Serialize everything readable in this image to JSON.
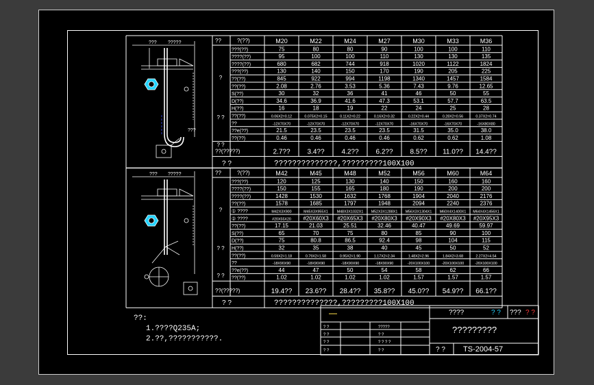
{
  "colors": {
    "paper": "#000000",
    "line": "#ffffff",
    "accent_cyan": "#23d3ff",
    "accent_red": "#ff3b3b",
    "accent_yellow": "#ffe14a",
    "dim_blue": "#3a4bff"
  },
  "table1": {
    "hdr_a": "??",
    "hdr_b": "?(??)",
    "sizes": [
      "M20",
      "M22",
      "M24",
      "M27",
      "M30",
      "M33",
      "M36"
    ],
    "group_labels": [
      "?",
      "?\n?",
      "?\n?"
    ],
    "rows": [
      {
        "label": "???(??)",
        "v": [
          "75",
          "80",
          "80",
          "90",
          "100",
          "100",
          "110"
        ]
      },
      {
        "label": "????(??)",
        "v": [
          "95",
          "100",
          "100",
          "110",
          "130",
          "130",
          "135"
        ]
      },
      {
        "label": "????(??)",
        "v": [
          "680",
          "682",
          "744",
          "918",
          "1020",
          "1122",
          "1824"
        ]
      },
      {
        "label": "???(??)",
        "v": [
          "130",
          "140",
          "150",
          "170",
          "190",
          "205",
          "225"
        ]
      },
      {
        "label": "??(??)",
        "v": [
          "845",
          "922",
          "994",
          "1198",
          "1340",
          "1457",
          "1584"
        ]
      },
      {
        "label": "??(??)",
        "v": [
          "2.08",
          "2.76",
          "3.53",
          "5.36",
          "7.43",
          "9.76",
          "12.65"
        ]
      },
      {
        "label": "S(??)",
        "v": [
          "30",
          "32",
          "36",
          "41",
          "46",
          "50",
          "55"
        ]
      },
      {
        "label": "D(??)",
        "v": [
          "34.6",
          "36.9",
          "41.6",
          "47.3",
          "53.1",
          "57.7",
          "63.5"
        ]
      },
      {
        "label": "H(??)",
        "v": [
          "16",
          "18",
          "19",
          "22",
          "24",
          "25",
          "28"
        ]
      },
      {
        "label": "??(??)",
        "v": [
          "0.06X2=0.12",
          "0.075X2=0.15",
          "0.11X2=0.22",
          "0.16X2=0.32",
          "0.22X2=0.44",
          "0.28X2=0.56",
          "0.37X2=0.74"
        ]
      },
      {
        "label": "??",
        "v": [
          "-12X70X70",
          "-12X70X70",
          "-12X70X70",
          "-12X70X70",
          "-16X70X70",
          "-16X70X70",
          "-16X80X80"
        ]
      },
      {
        "label": "??e(??)",
        "v": [
          "21.5",
          "23.5",
          "23.5",
          "23.5",
          "31.5",
          "35.0",
          "38.0"
        ]
      },
      {
        "label": "??(??)",
        "v": [
          "0.46",
          "0.46",
          "0.46",
          "0.46",
          "0.62",
          "0.62",
          "1.08"
        ]
      }
    ],
    "total_label": "??(?????)",
    "totals": [
      "2.7??",
      "3.4??",
      "4.2??",
      "6.2??",
      "8.5??",
      "11.0??",
      "14.4??"
    ],
    "note_left": "?    ?",
    "note_text": "??????????????,?????????100X100"
  },
  "table2": {
    "hdr_a": "??",
    "hdr_b": "?(??)",
    "sizes": [
      "M42",
      "M45",
      "M48",
      "M52",
      "M56",
      "M60",
      "M64"
    ],
    "rows": [
      {
        "label": "???(??)",
        "v": [
          "120",
          "125",
          "130",
          "140",
          "150",
          "160",
          "160"
        ]
      },
      {
        "label": "????(??)",
        "v": [
          "150",
          "155",
          "165",
          "180",
          "190",
          "200",
          "200"
        ]
      },
      {
        "label": "????(??)",
        "v": [
          "1428",
          "1530",
          "1632",
          "1768",
          "1904",
          "2040",
          "2176"
        ]
      },
      {
        "label": "??(??)",
        "v": [
          "1578",
          "1685",
          "1797",
          "1948",
          "2094",
          "2240",
          "2376"
        ]
      },
      {
        "label": "① ????",
        "v": [
          "M42X3X900",
          "M45X3X955X1",
          "M48X3X1032X1",
          "M52X3X1288X1",
          "M56X3X1304X1",
          "M60X4X1400X1",
          "M64X4X1456X1"
        ]
      },
      {
        "label": "② ????",
        "v": [
          "#20X55X20",
          "#20X60X3",
          "#20X65X3",
          "#20X80X3",
          "#20X90X3",
          "#20X80X3",
          "#20X95X3"
        ]
      },
      {
        "label": "??(??)",
        "v": [
          "17.15",
          "21.03",
          "25.51",
          "32.46",
          "40.47",
          "49.69",
          "59.97"
        ]
      },
      {
        "label": "S(??)",
        "v": [
          "65",
          "70",
          "75",
          "80",
          "85",
          "90",
          "100"
        ]
      },
      {
        "label": "D(??)",
        "v": [
          "75",
          "80.8",
          "86.5",
          "92.4",
          "98",
          "104",
          "115"
        ]
      },
      {
        "label": "H(??)",
        "v": [
          "32",
          "35",
          "38",
          "40",
          "45",
          "50",
          "52"
        ]
      },
      {
        "label": "??(??)",
        "v": [
          "0.59X2=1.18",
          "0.79X2=1.58",
          "0.95X2=1.90",
          "1.17X2=2.34",
          "1.48X2=2.96",
          "1.84X2=3.68",
          "2.27X2=4.54"
        ]
      },
      {
        "label": "??",
        "v": [
          "-18X90X90",
          "-18X90X90",
          "-18X90X90",
          "-18X90X90",
          "-20X100X100",
          "-20X100X100",
          "-20X100X100"
        ]
      },
      {
        "label": "??e(??)",
        "v": [
          "44",
          "47",
          "50",
          "54",
          "58",
          "62",
          "66"
        ]
      },
      {
        "label": "??(??)",
        "v": [
          "1.02",
          "1.02",
          "1.02",
          "1.02",
          "1.57",
          "1.57",
          "1.57"
        ]
      }
    ],
    "total_label": "??(?????)",
    "totals": [
      "19.4??",
      "23.6??",
      "28.4??",
      "35.8??",
      "45.0??",
      "54.9??",
      "66.1??"
    ],
    "note_left": "?    ?",
    "note_text": "??????????????,?????????100X100"
  },
  "notes": {
    "title": "??:",
    "line1": "1.????Q235A;",
    "line2": "2.??,???????????."
  },
  "titleblock": {
    "header_left": "????",
    "header_cyan": "? ?",
    "header_right": "???",
    "header_red": "? ?",
    "main_title": "?????????",
    "bottom_left": "?  ?",
    "drawing_no": "TS-2004-57",
    "sig_cells": [
      "?     ?",
      "?     ?",
      "?     ?",
      "?     ?"
    ],
    "mid_cells": [
      "?????",
      "?    ?",
      "? ? ? ?",
      "?    ?"
    ]
  },
  "drawing": {
    "dim_top_a": "???",
    "dim_top_b": "?????",
    "dim_side": "???",
    "dim_bottom": "???"
  }
}
